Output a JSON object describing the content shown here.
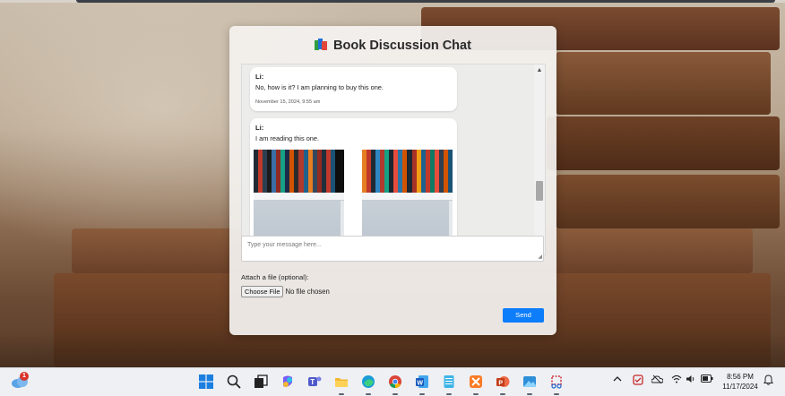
{
  "chat": {
    "title": "Book Discussion Chat",
    "messages": [
      {
        "sender": "Li:",
        "text": "No, how is it? I am planning to buy this one.",
        "timestamp": "November 15, 2024, 9:55 am"
      },
      {
        "sender": "Li:",
        "text": "I am reading this one.",
        "attachments": [
          "bookshelf-photo",
          "bookshelf-photo"
        ]
      }
    ],
    "composer_placeholder": "Type your message here...",
    "attach_label": "Attach a file (optional):",
    "choose_file_label": "Choose File",
    "no_file_text": "No file chosen",
    "send_label": "Send"
  },
  "colors": {
    "accent": "#0d7dfa",
    "panel": "#f4f2f0",
    "taskbar": "#eef0f4"
  },
  "taskbar": {
    "weather_badge": "1",
    "pinned_apps": [
      "start",
      "search",
      "task-view",
      "copilot",
      "teams",
      "file-explorer",
      "edge",
      "chrome",
      "word",
      "notepad",
      "xampp",
      "powerpoint",
      "paint",
      "snipping-tool"
    ],
    "tray_icons": [
      "chevron-up",
      "security",
      "onedrive",
      "wifi",
      "volume",
      "battery"
    ],
    "time": "8:56 PM",
    "date": "11/17/2024"
  }
}
